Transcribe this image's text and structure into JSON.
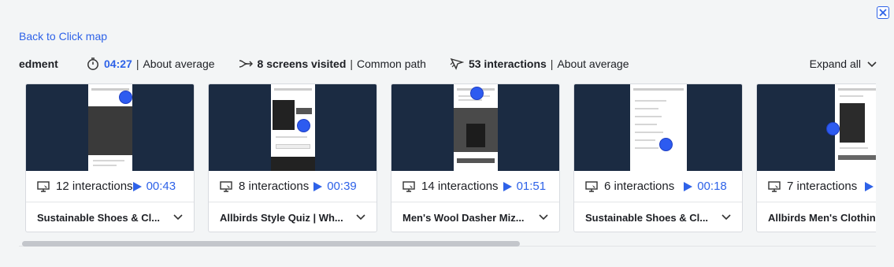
{
  "back_link": "Back to Click map",
  "participant": "edment",
  "stats": {
    "time": {
      "value": "04:27",
      "label": "About average",
      "icon": "stopwatch-icon"
    },
    "screens": {
      "value": "8 screens visited",
      "label": "Common path",
      "icon": "path-icon"
    },
    "interactions": {
      "value": "53 interactions",
      "label": "About average",
      "icon": "cursor-icon"
    }
  },
  "expand_all": "Expand all",
  "accent_color": "#2e62e8",
  "cards": [
    {
      "interactions": "12 interactions",
      "time": "00:43",
      "title": "Sustainable Shoes & Cl..."
    },
    {
      "interactions": "8 interactions",
      "time": "00:39",
      "title": "Allbirds Style Quiz | Wh..."
    },
    {
      "interactions": "14 interactions",
      "time": "01:51",
      "title": "Men's Wool Dasher Miz..."
    },
    {
      "interactions": "6 interactions",
      "time": "00:18",
      "title": "Sustainable Shoes & Cl..."
    },
    {
      "interactions": "7 interactions",
      "time": "",
      "title": "Allbirds Men's Clothin"
    }
  ]
}
